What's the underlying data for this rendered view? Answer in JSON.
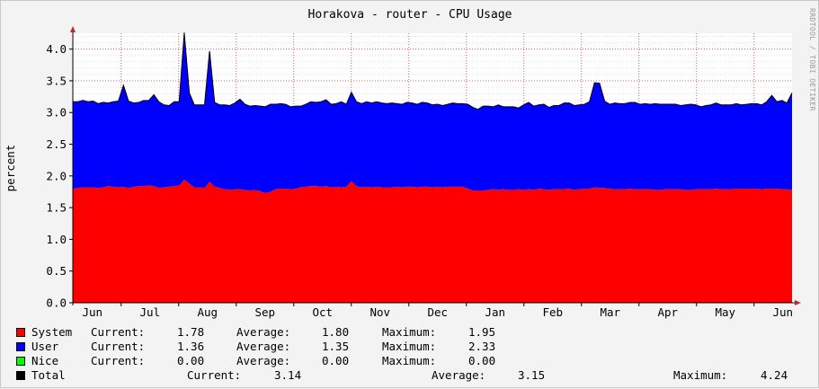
{
  "chart_data": {
    "type": "area",
    "title": "Horakova - router - CPU Usage",
    "ylabel": "percent",
    "xlabel": "",
    "ylim": [
      0,
      4.25
    ],
    "y_ticks": [
      "0.0",
      "0.5",
      "1.0",
      "1.5",
      "2.0",
      "2.5",
      "3.0",
      "3.5",
      "4.0"
    ],
    "x_ticks": [
      "Jun",
      "Jul",
      "Aug",
      "Sep",
      "Oct",
      "Nov",
      "Dec",
      "Jan",
      "Feb",
      "Mar",
      "Apr",
      "May",
      "Jun"
    ],
    "grid": true,
    "stacked": true,
    "watermark": "RRDTOOL / TOBI OETIKER",
    "colors": {
      "system": "#ff0000",
      "user": "#0000ff",
      "nice": "#00ff00",
      "total": "#000000",
      "grid": "#e06060",
      "axis": "#000000",
      "background": "#ffffff"
    },
    "series": [
      {
        "name": "System",
        "values": [
          1.8,
          1.81,
          1.82,
          1.82,
          1.82,
          1.81,
          1.82,
          1.84,
          1.83,
          1.82,
          1.83,
          1.81,
          1.83,
          1.84,
          1.84,
          1.85,
          1.84,
          1.81,
          1.82,
          1.83,
          1.84,
          1.85,
          1.94,
          1.88,
          1.82,
          1.82,
          1.81,
          1.91,
          1.83,
          1.81,
          1.79,
          1.78,
          1.79,
          1.79,
          1.78,
          1.77,
          1.78,
          1.76,
          1.73,
          1.75,
          1.79,
          1.8,
          1.8,
          1.79,
          1.8,
          1.82,
          1.83,
          1.84,
          1.84,
          1.83,
          1.84,
          1.82,
          1.83,
          1.82,
          1.83,
          1.92,
          1.84,
          1.82,
          1.83,
          1.82,
          1.83,
          1.82,
          1.82,
          1.82,
          1.83,
          1.82,
          1.83,
          1.83,
          1.82,
          1.83,
          1.83,
          1.82,
          1.83,
          1.82,
          1.83,
          1.83,
          1.83,
          1.83,
          1.8,
          1.77,
          1.77,
          1.77,
          1.78,
          1.79,
          1.78,
          1.79,
          1.78,
          1.78,
          1.79,
          1.78,
          1.79,
          1.78,
          1.8,
          1.79,
          1.78,
          1.79,
          1.79,
          1.79,
          1.8,
          1.78,
          1.79,
          1.8,
          1.8,
          1.82,
          1.81,
          1.81,
          1.8,
          1.79,
          1.79,
          1.79,
          1.8,
          1.79,
          1.79,
          1.79,
          1.79,
          1.78,
          1.78,
          1.79,
          1.79,
          1.79,
          1.79,
          1.78,
          1.78,
          1.79,
          1.79,
          1.79,
          1.79,
          1.8,
          1.79,
          1.79,
          1.79,
          1.8,
          1.8,
          1.8,
          1.8,
          1.8,
          1.79,
          1.8,
          1.8,
          1.8,
          1.79,
          1.79,
          1.78
        ],
        "current": "1.78",
        "average": "1.80",
        "maximum": "1.95"
      },
      {
        "name": "User",
        "values": [
          1.37,
          1.36,
          1.37,
          1.35,
          1.36,
          1.33,
          1.34,
          1.31,
          1.34,
          1.36,
          1.6,
          1.37,
          1.32,
          1.32,
          1.35,
          1.34,
          1.44,
          1.36,
          1.3,
          1.28,
          1.33,
          1.32,
          2.32,
          1.43,
          1.3,
          1.3,
          1.31,
          2.06,
          1.33,
          1.31,
          1.33,
          1.33,
          1.36,
          1.42,
          1.35,
          1.33,
          1.33,
          1.34,
          1.36,
          1.38,
          1.34,
          1.34,
          1.33,
          1.3,
          1.3,
          1.28,
          1.3,
          1.33,
          1.32,
          1.34,
          1.36,
          1.31,
          1.31,
          1.35,
          1.3,
          1.4,
          1.33,
          1.32,
          1.34,
          1.33,
          1.34,
          1.33,
          1.32,
          1.33,
          1.31,
          1.31,
          1.33,
          1.32,
          1.31,
          1.33,
          1.32,
          1.3,
          1.3,
          1.29,
          1.3,
          1.32,
          1.31,
          1.31,
          1.33,
          1.31,
          1.28,
          1.33,
          1.32,
          1.3,
          1.34,
          1.3,
          1.31,
          1.31,
          1.28,
          1.34,
          1.37,
          1.32,
          1.32,
          1.34,
          1.3,
          1.32,
          1.32,
          1.36,
          1.35,
          1.33,
          1.33,
          1.33,
          1.37,
          1.65,
          1.65,
          1.37,
          1.33,
          1.36,
          1.35,
          1.35,
          1.36,
          1.37,
          1.34,
          1.35,
          1.34,
          1.36,
          1.35,
          1.34,
          1.34,
          1.34,
          1.32,
          1.34,
          1.35,
          1.33,
          1.3,
          1.32,
          1.33,
          1.35,
          1.33,
          1.33,
          1.33,
          1.34,
          1.32,
          1.33,
          1.34,
          1.34,
          1.33,
          1.37,
          1.47,
          1.37,
          1.4,
          1.36,
          1.53,
          1.38,
          1.36
        ],
        "current": "1.36",
        "average": "1.35",
        "maximum": "2.33"
      },
      {
        "name": "Nice",
        "values": [],
        "current": "0.00",
        "average": "0.00",
        "maximum": "0.00"
      },
      {
        "name": "Total",
        "values": [],
        "current": "3.14",
        "average": "3.15",
        "maximum": "4.24"
      }
    ]
  },
  "legend": {
    "current_label": "Current:",
    "average_label": "Average:",
    "maximum_label": "Maximum:"
  }
}
